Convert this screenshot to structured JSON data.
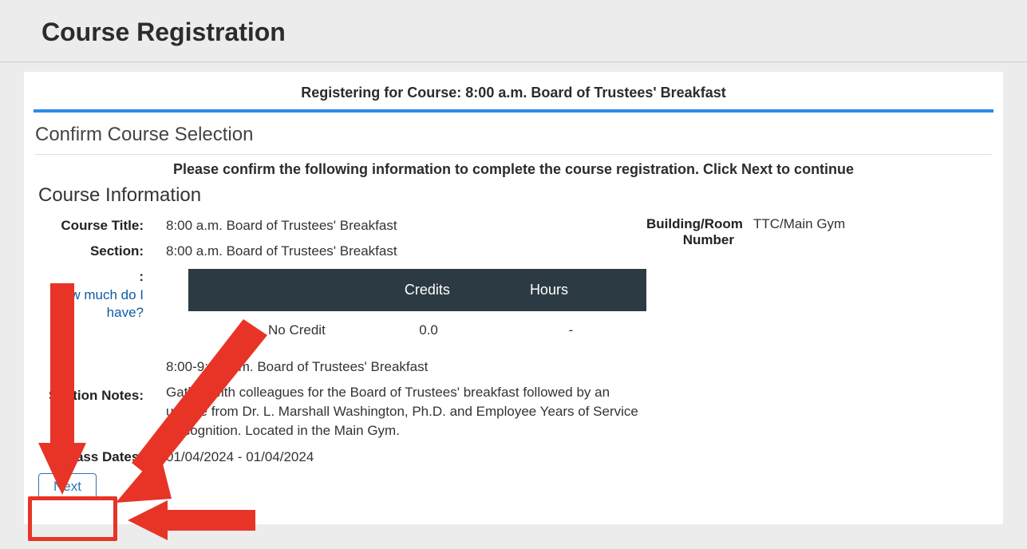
{
  "page_title": "Course Registration",
  "registering_prefix": "Registering for Course: ",
  "course_name_header": "8:00 a.m. Board of Trustees' Breakfast",
  "sub_heading": "Confirm Course Selection",
  "confirm_line": "Please confirm the following information to complete the course registration. Click Next to continue",
  "info_heading": "Course Information",
  "labels": {
    "course_title": "Course Title:",
    "section": "Section:",
    "colon": ":",
    "how_much": "How much do I have?",
    "section_notes": "Section Notes:",
    "class_dates": "Class Dates:",
    "building": "Building/Room Number"
  },
  "values": {
    "course_title": "8:00 a.m. Board of Trustees' Breakfast",
    "section": "8:00 a.m. Board of Trustees' Breakfast",
    "section_notes_line1": "8:00-9:10 a.m.  Board of Trustees' Breakfast",
    "section_notes_body": "Gather with colleagues for the Board of Trustees' breakfast followed by an update from Dr. L. Marshall Washington, Ph.D. and Employee Years of Service Recognition.  Located in the Main Gym.",
    "class_dates": "01/04/2024 - 01/04/2024",
    "building": "TTC/Main Gym"
  },
  "credits_table": {
    "headers": {
      "blank": "",
      "credits": "Credits",
      "hours": "Hours",
      "blank2": ""
    },
    "row": {
      "name": "No Credit",
      "credits": "0.0",
      "hours": "-"
    }
  },
  "next_label": "Next"
}
